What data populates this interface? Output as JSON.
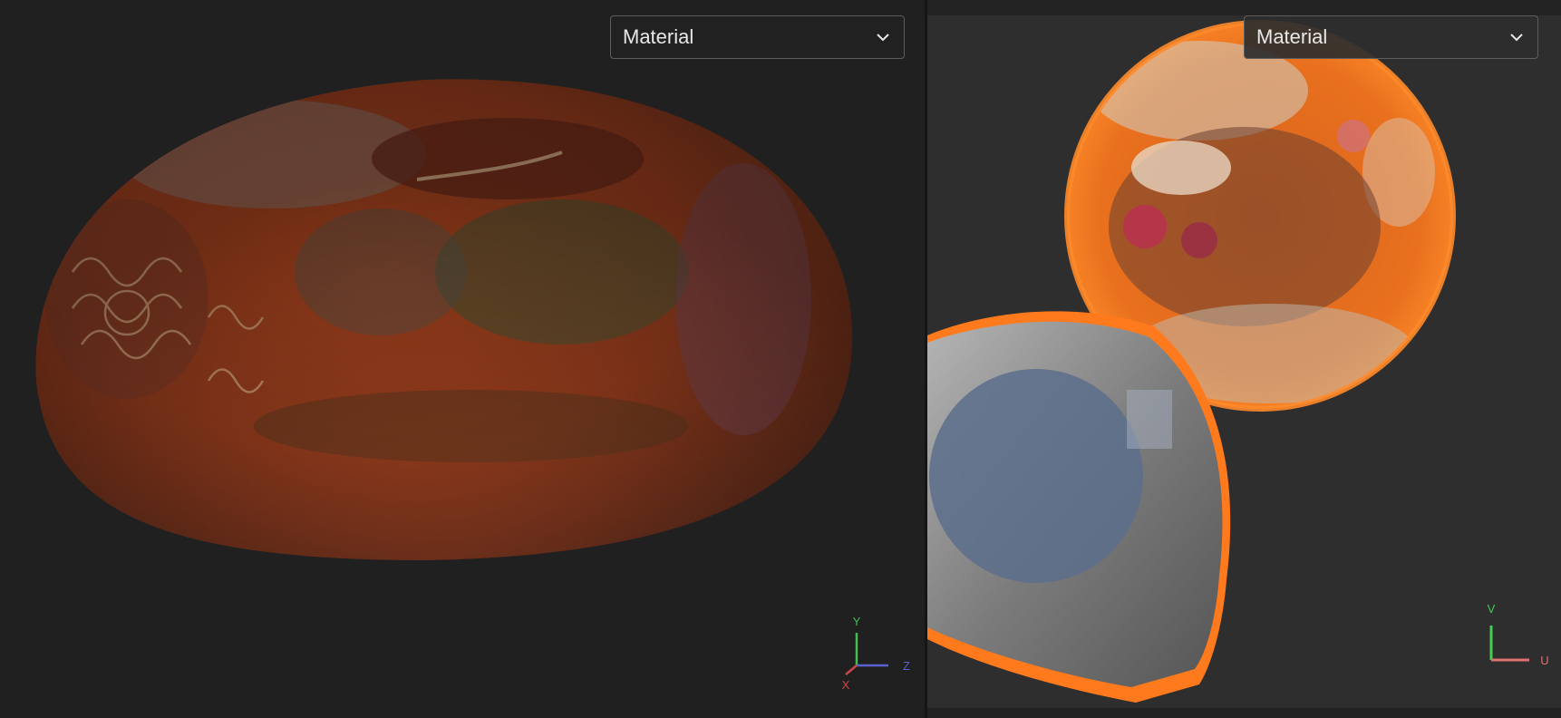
{
  "viewport_3d": {
    "render_mode": {
      "selected": "Material",
      "icon": "chevron-down-icon"
    },
    "axis_gizmo": {
      "y": "Y",
      "z": "Z",
      "x": "X"
    }
  },
  "viewport_uv": {
    "render_mode": {
      "selected": "Material",
      "icon": "chevron-down-icon"
    },
    "axis_gizmo": {
      "v": "V",
      "u": "U"
    }
  },
  "colors": {
    "background": "#1e1e1e",
    "uv_canvas": "#2e2e2e",
    "dropdown_border": "#5d5d5d",
    "text": "#e8e8e8",
    "axis_x": "#d04545",
    "axis_y": "#3fbf4f",
    "axis_z": "#5b5fd0",
    "axis_u": "#e07070",
    "axis_v": "#44cc55"
  }
}
